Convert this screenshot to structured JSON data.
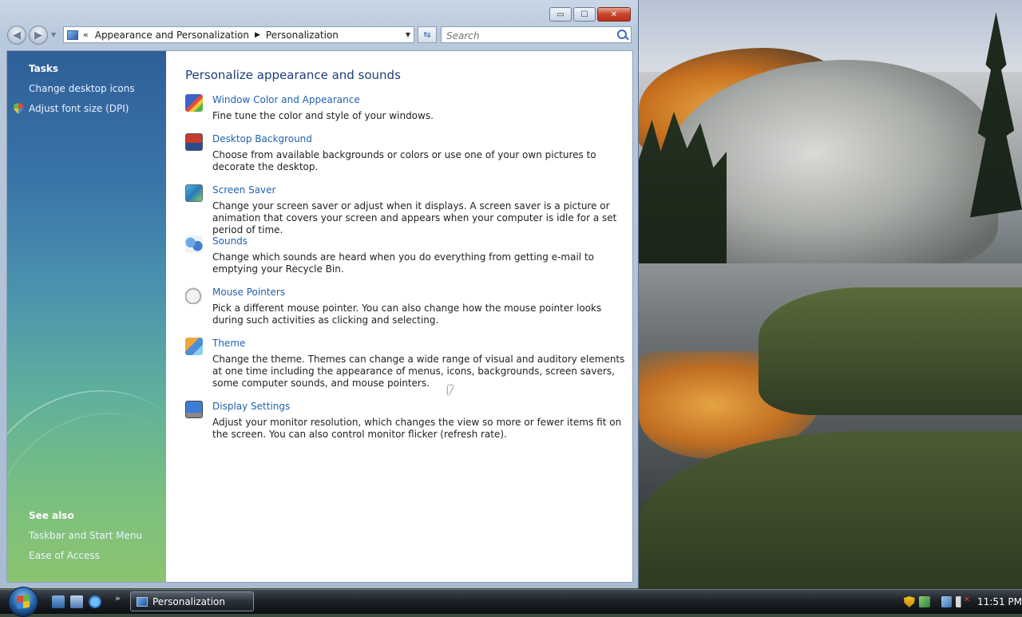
{
  "window": {
    "title": "Personalization",
    "controls": {
      "minimize": "▭",
      "maximize": "☐",
      "close": "✕"
    }
  },
  "navigation": {
    "back_icon": "arrow-left-icon",
    "forward_icon": "arrow-right-icon",
    "address_prefix": "«",
    "breadcrumb": [
      "Appearance and Personalization",
      "Personalization"
    ],
    "separator": "▶",
    "dropdown": "▼",
    "refresh": "⇆",
    "search_placeholder": "Search"
  },
  "taskpane": {
    "tasks_heading": "Tasks",
    "tasks": [
      "Change desktop icons",
      "Adjust font size (DPI)"
    ],
    "see_also_heading": "See also",
    "see_also": [
      "Taskbar and Start Menu",
      "Ease of Access"
    ]
  },
  "main": {
    "title": "Personalize appearance and sounds",
    "items": [
      {
        "label": "Window Color and Appearance",
        "desc": "Fine tune the color and style of your windows.",
        "icon": "window-color-icon"
      },
      {
        "label": "Desktop Background",
        "desc": "Choose from available backgrounds or colors or use one of your own pictures to decorate the desktop.",
        "icon": "desktop-background-icon"
      },
      {
        "label": "Screen Saver",
        "desc": "Change your screen saver or adjust when it displays. A screen saver is a picture or animation that covers your screen and appears when your computer is idle for a set period of time.",
        "icon": "screen-saver-icon"
      },
      {
        "label": "Sounds",
        "desc": "Change which sounds are heard when you do everything from getting e-mail to emptying your Recycle Bin.",
        "icon": "sounds-icon"
      },
      {
        "label": "Mouse Pointers",
        "desc": "Pick a different mouse pointer. You can also change how the mouse pointer looks during such activities as clicking and selecting.",
        "icon": "mouse-pointer-icon"
      },
      {
        "label": "Theme",
        "desc": "Change the theme. Themes can change a wide range of visual and auditory elements at one time including the appearance of menus, icons, backgrounds, screen savers, some computer sounds, and mouse pointers.",
        "icon": "theme-icon"
      },
      {
        "label": "Display Settings",
        "desc": "Adjust your monitor resolution, which changes the view so more or fewer items fit on the screen. You can also control monitor flicker (refresh rate).",
        "icon": "display-settings-icon"
      }
    ]
  },
  "taskbar": {
    "quick_launch_more": "»",
    "active_task": "Personalization",
    "clock": "11:51 PM"
  },
  "colors": {
    "link": "#1f63b0",
    "title": "#1e3f78",
    "taskpane_top": "#2f5f98",
    "taskpane_bottom": "#8bc471"
  }
}
